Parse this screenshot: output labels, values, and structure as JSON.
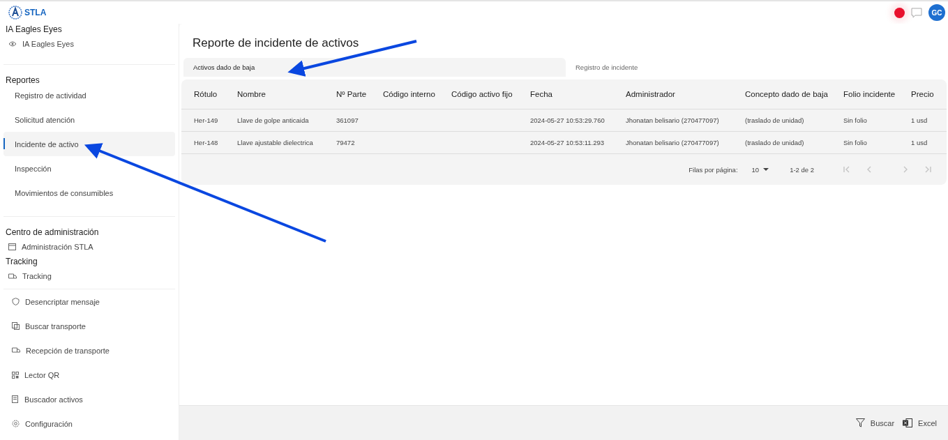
{
  "header": {
    "brand": "STLA",
    "avatar": "GC"
  },
  "sidebar": {
    "sections": [
      {
        "title": "IA Eagles Eyes",
        "items": [
          {
            "label": "IA Eagles Eyes",
            "selected": false
          }
        ]
      },
      {
        "title": "Reportes",
        "items": [
          {
            "label": "Registro de actividad",
            "selected": false
          },
          {
            "label": "Solicitud atención",
            "selected": false
          },
          {
            "label": "Incidente de activo",
            "selected": true
          },
          {
            "label": "Inspección",
            "selected": false
          },
          {
            "label": "Movimientos de consumibles",
            "selected": false
          }
        ]
      },
      {
        "title": "Centro de administración",
        "items": [
          {
            "label": "Administración STLA",
            "selected": false
          }
        ]
      },
      {
        "title": "Tracking",
        "items": [
          {
            "label": "Tracking",
            "selected": false
          }
        ]
      }
    ],
    "bottom_items": [
      {
        "label": "Desencriptar mensaje"
      },
      {
        "label": "Buscar transporte"
      },
      {
        "label": "Recepción de transporte"
      },
      {
        "label": "Lector QR"
      },
      {
        "label": "Buscador activos"
      },
      {
        "label": "Configuración"
      }
    ]
  },
  "page": {
    "title": "Reporte de incidente de activos",
    "tabs": [
      {
        "label": "Activos dado de baja",
        "selected": true
      },
      {
        "label": "Registro de incidente",
        "selected": false
      }
    ],
    "table": {
      "columns": [
        "Rótulo",
        "Nombre",
        "Nº Parte",
        "Código interno",
        "Código activo fijo",
        "Fecha",
        "Administrador",
        "Concepto dado de baja",
        "Folio incidente",
        "Precio"
      ],
      "rows": [
        [
          "Her-149",
          "Llave de golpe anticaida",
          "361097",
          "",
          "",
          "2024-05-27 10:53:29.760",
          "Jhonatan belisario  (270477097)",
          "(traslado de unidad)",
          "Sin folio",
          "1 usd"
        ],
        [
          "Her-148",
          "Llave ajustable dielectrica",
          "79472",
          "",
          "",
          "2024-05-27 10:53:11.293",
          "Jhonatan belisario  (270477097)",
          "(traslado de unidad)",
          "Sin folio",
          "1 usd"
        ]
      ]
    },
    "pagination": {
      "rows_label": "Filas por página:",
      "rows_per_page": "10",
      "range": "1-2 de 2",
      "first_disabled": true,
      "prev_disabled": true,
      "next_disabled": true,
      "last_disabled": true
    }
  },
  "footer": {
    "buttons": [
      "Buscar",
      "Excel"
    ]
  }
}
